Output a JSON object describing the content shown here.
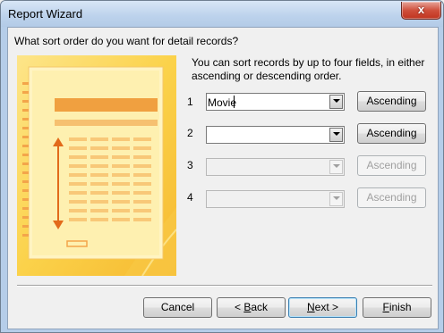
{
  "window": {
    "title": "Report Wizard",
    "close_glyph": "x"
  },
  "question": "What sort order do you want for detail records?",
  "description": "You can sort records by up to four fields, in either ascending or descending order.",
  "sort_rows": [
    {
      "number": "1",
      "field": "Movie",
      "order": "Ascending",
      "enabled": true
    },
    {
      "number": "2",
      "field": "",
      "order": "Ascending",
      "enabled": true
    },
    {
      "number": "3",
      "field": "",
      "order": "Ascending",
      "enabled": false
    },
    {
      "number": "4",
      "field": "",
      "order": "Ascending",
      "enabled": false
    }
  ],
  "buttons": {
    "cancel": "Cancel",
    "back_prefix": "< ",
    "back_accel": "B",
    "back_rest": "ack",
    "next_accel": "N",
    "next_rest": "ext >",
    "finish_accel": "F",
    "finish_rest": "inish"
  },
  "colors": {
    "preview_bg": "#fbd24a",
    "preview_header": "#f0a040",
    "window_frame": "#b5cde9",
    "close_red": "#c0341f"
  }
}
